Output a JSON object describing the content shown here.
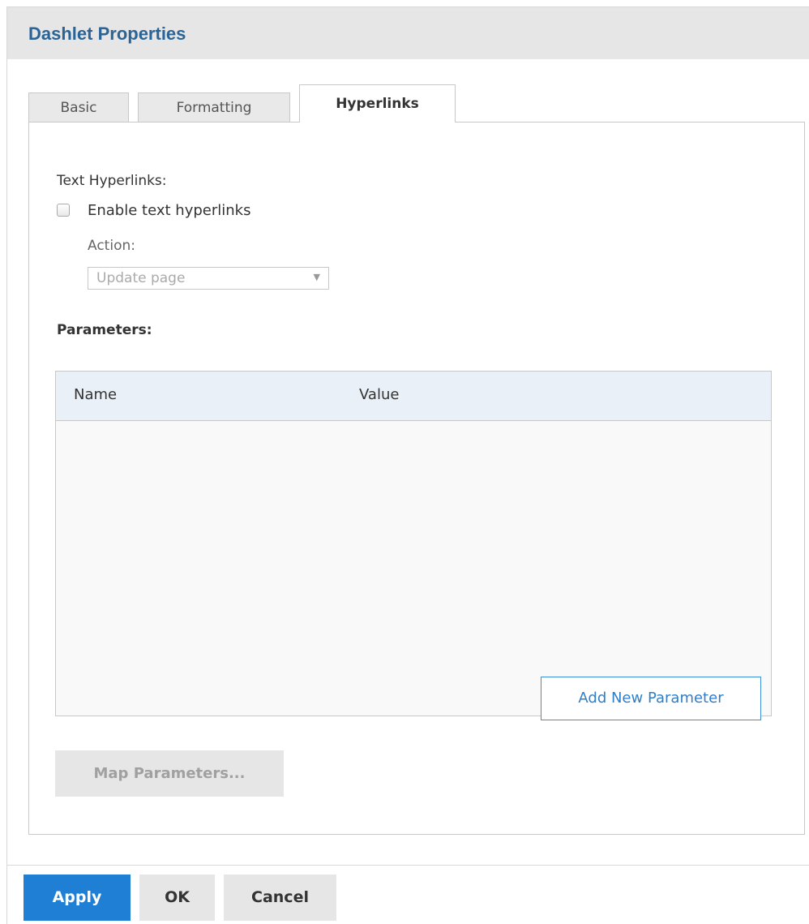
{
  "dialog": {
    "title": "Dashlet Properties"
  },
  "tabs": [
    {
      "label": "Basic",
      "active": false
    },
    {
      "label": "Formatting",
      "active": false
    },
    {
      "label": "Hyperlinks",
      "active": true
    }
  ],
  "hyperlinks": {
    "section_label": "Text Hyperlinks:",
    "enable_checkbox": {
      "label": "Enable text hyperlinks",
      "checked": false
    },
    "action_label": "Action:",
    "action_select": {
      "value": "Update page",
      "enabled": false
    }
  },
  "parameters": {
    "label": "Parameters:",
    "columns": [
      "Name",
      "Value"
    ],
    "rows": [],
    "add_button": "Add New Parameter"
  },
  "map_parameters_button": "Map Parameters...",
  "footer": {
    "apply": "Apply",
    "ok": "OK",
    "cancel": "Cancel"
  },
  "colors": {
    "title": "#2a6496",
    "primary_button": "#1f7fd4",
    "link_button_border": "#3d8fd8",
    "table_header": "#eaf0f8"
  }
}
